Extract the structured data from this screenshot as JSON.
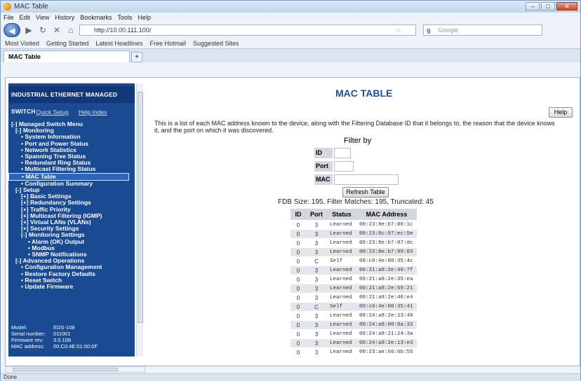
{
  "window": {
    "title": "MAC Table"
  },
  "menubar": [
    "File",
    "Edit",
    "View",
    "History",
    "Bookmarks",
    "Tools",
    "Help"
  ],
  "nav": {
    "url": "http://10.00.111.100/",
    "search_placeholder": "Google"
  },
  "bookmarks": [
    "Most Visited",
    "Getting Started",
    "Latest Headlines",
    "Free Hotmail",
    "Suggested Sites"
  ],
  "tab": {
    "label": "MAC Table"
  },
  "sidebar": {
    "header": "INDUSTRIAL ETHERNET MANAGED SWITCH",
    "quick_setup": "Quick Setup",
    "help_index": "Help Index",
    "tree": [
      {
        "label": "[-] Managed Switch Menu",
        "level": 0
      },
      {
        "label": "[-] Monitoring",
        "level": 1
      },
      {
        "label": "• System Information",
        "level": 2
      },
      {
        "label": "• Port and Power Status",
        "level": 2
      },
      {
        "label": "• Network Statistics",
        "level": 2
      },
      {
        "label": "• Spanning Tree Status",
        "level": 2
      },
      {
        "label": "• Redundant Ring Status",
        "level": 2
      },
      {
        "label": "• Multicast Filtering Status",
        "level": 2
      },
      {
        "label": "• MAC Table",
        "level": 2,
        "selected": true
      },
      {
        "label": "• Configuration Summary",
        "level": 2
      },
      {
        "label": "[-] Setup",
        "level": 1
      },
      {
        "label": "[+] Basic Settings",
        "level": 2
      },
      {
        "label": "[+] Redundancy Settings",
        "level": 2
      },
      {
        "label": "[+] Traffic Priority",
        "level": 2
      },
      {
        "label": "[+] Multicast Filtering (IGMP)",
        "level": 2
      },
      {
        "label": "[+] Virtual LANs (VLANs)",
        "level": 2
      },
      {
        "label": "[+] Security Settings",
        "level": 2
      },
      {
        "label": "[-] Monitoring Settings",
        "level": 2
      },
      {
        "label": "• Alarm (OK) Output",
        "level": 3
      },
      {
        "label": "• Modbus",
        "level": 3
      },
      {
        "label": "• SNMP Notifications",
        "level": 3
      },
      {
        "label": "[-] Advanced Operations",
        "level": 1
      },
      {
        "label": "• Configuration Management",
        "level": 2
      },
      {
        "label": "• Restore Factory Defaults",
        "level": 2
      },
      {
        "label": "• Reset Switch",
        "level": 2
      },
      {
        "label": "• Update Firmware",
        "level": 2
      }
    ],
    "info": [
      {
        "k": "Model:",
        "v": "EDS-108"
      },
      {
        "k": "Serial number:",
        "v": "011001"
      },
      {
        "k": "Firmware rev:",
        "v": "3.0.108"
      },
      {
        "k": "MAC address:",
        "v": "00:C0:4E:01:00:0F"
      }
    ]
  },
  "main": {
    "title": "MAC TABLE",
    "help_label": "Help",
    "description": "This is a list of each MAC address known to the device, along with the Filtering Database ID that it belongs to, the reason that the device knows it, and the port on which it was discovered.",
    "filter_title": "Filter by",
    "filter_id_label": "ID",
    "filter_port_label": "Port",
    "filter_mac_label": "MAC",
    "refresh_label": "Refresh Table",
    "fdb_stats": "FDB Size: 195, Filter Matches: 195, Truncated: 45",
    "table": {
      "headers": [
        "ID",
        "Port",
        "Status",
        "MAC Address"
      ],
      "rows": [
        [
          "0",
          "3",
          "Learned",
          "00:23:8e:b7:00:1c"
        ],
        [
          "0",
          "3",
          "Learned",
          "00:23:8c:97:ec:5e"
        ],
        [
          "0",
          "3",
          "Learned",
          "00:23:8e:b7:07:dc"
        ],
        [
          "0",
          "3",
          "Learned",
          "00:23:8e:b7:09:03"
        ],
        [
          "0",
          "C",
          "Self",
          "00:c0:4e:00:35:4c"
        ],
        [
          "0",
          "3",
          "Learned",
          "00:21:a8:2e:40:7f"
        ],
        [
          "0",
          "3",
          "Learned",
          "00:21:a8:2e:35:ea"
        ],
        [
          "0",
          "3",
          "Learned",
          "00:21:a8:2e:69:21"
        ],
        [
          "0",
          "3",
          "Learned",
          "00:21:a8:2e:40:e4"
        ],
        [
          "0",
          "C",
          "Self",
          "00:c0:4e:00:35:41"
        ],
        [
          "0",
          "3",
          "Learned",
          "00:24:a8:2e:13:40"
        ],
        [
          "0",
          "3",
          "Learned",
          "00:24:a8:00:0a:33"
        ],
        [
          "0",
          "3",
          "Learned",
          "00:24:a8:21:24:3a"
        ],
        [
          "0",
          "3",
          "Learned",
          "00:24:a8:2e:13:e3"
        ],
        [
          "0",
          "3",
          "Learned",
          "00:23:ae:66:6b:55"
        ]
      ]
    }
  },
  "status": {
    "text": "Done"
  }
}
